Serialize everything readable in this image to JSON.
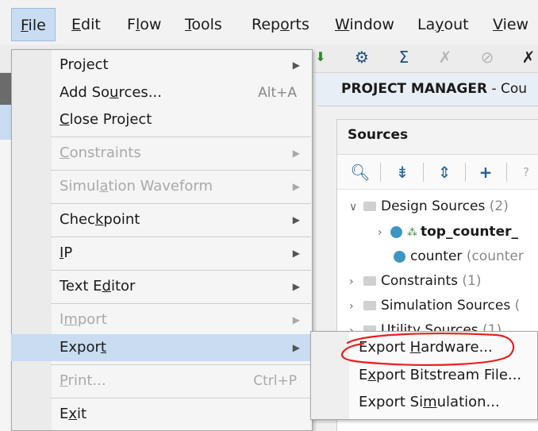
{
  "menubar": {
    "items": [
      {
        "pre": "",
        "mn": "F",
        "post": "ile"
      },
      {
        "pre": "",
        "mn": "E",
        "post": "dit"
      },
      {
        "pre": "F",
        "mn": "l",
        "post": "ow"
      },
      {
        "pre": "",
        "mn": "T",
        "post": "ools"
      },
      {
        "pre": "Rep",
        "mn": "o",
        "post": "rts"
      },
      {
        "pre": "",
        "mn": "W",
        "post": "indow"
      },
      {
        "pre": "La",
        "mn": "y",
        "post": "out"
      },
      {
        "pre": "",
        "mn": "V",
        "post": "iew"
      }
    ]
  },
  "file_menu": {
    "items": [
      {
        "pre": "Pro",
        "mn": "j",
        "post": "ect",
        "accel": "",
        "submenu": true,
        "enabled": true
      },
      {
        "pre": "Add So",
        "mn": "u",
        "post": "rces...",
        "accel": "Alt+A",
        "submenu": false,
        "enabled": true
      },
      {
        "pre": "",
        "mn": "C",
        "post": "lose Project",
        "accel": "",
        "submenu": false,
        "enabled": true
      },
      {
        "pre": "",
        "mn": "C",
        "post": "onstraints",
        "accel": "",
        "submenu": true,
        "enabled": false
      },
      {
        "pre": "Simul",
        "mn": "a",
        "post": "tion Waveform",
        "accel": "",
        "submenu": true,
        "enabled": false
      },
      {
        "pre": "Chec",
        "mn": "k",
        "post": "point",
        "accel": "",
        "submenu": true,
        "enabled": true
      },
      {
        "pre": "",
        "mn": "I",
        "post": "P",
        "accel": "",
        "submenu": true,
        "enabled": true
      },
      {
        "pre": "Text E",
        "mn": "d",
        "post": "itor",
        "accel": "",
        "submenu": true,
        "enabled": true
      },
      {
        "pre": "I",
        "mn": "m",
        "post": "port",
        "accel": "",
        "submenu": true,
        "enabled": false
      },
      {
        "pre": "Expor",
        "mn": "t",
        "post": "",
        "accel": "",
        "submenu": true,
        "enabled": true
      },
      {
        "pre": "",
        "mn": "P",
        "post": "rint...",
        "accel": "Ctrl+P",
        "submenu": false,
        "enabled": false
      },
      {
        "pre": "E",
        "mn": "x",
        "post": "it",
        "accel": "",
        "submenu": false,
        "enabled": true
      }
    ]
  },
  "export_submenu": {
    "items": [
      {
        "pre": "Export ",
        "mn": "H",
        "post": "ardware..."
      },
      {
        "pre": "E",
        "mn": "x",
        "post": "port Bitstream File..."
      },
      {
        "pre": "Export Si",
        "mn": "m",
        "post": "ulation..."
      }
    ]
  },
  "project_manager": {
    "title_bold": "PROJECT MANAGER",
    "title_rest": " - Cou"
  },
  "sources": {
    "title": "Sources",
    "tree": [
      {
        "label": "Design Sources",
        "count": "(2)"
      },
      {
        "label": "top_counter_",
        "count": ""
      },
      {
        "label": "counter",
        "count": "(counter"
      },
      {
        "label": "Constraints",
        "count": "(1)"
      },
      {
        "label": "Simulation Sources",
        "count": "("
      },
      {
        "label": "Utility Sources",
        "count": "(1)"
      }
    ]
  },
  "annotation_color": "#e8201f"
}
